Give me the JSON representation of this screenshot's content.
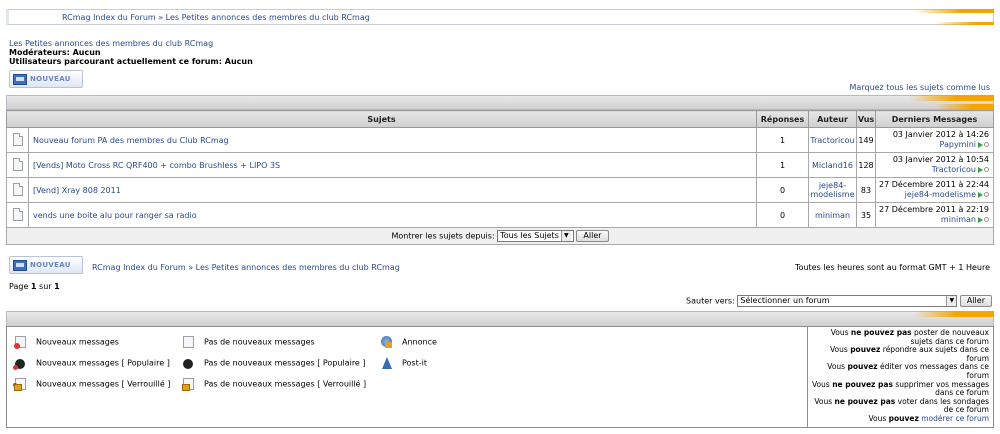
{
  "breadcrumb": {
    "index": "RCmag Index du Forum",
    "sep": " » ",
    "forum": "Les Petites annonces des membres du club RCmag"
  },
  "info": {
    "forum_title": "Les Petites annonces des membres du club RCmag",
    "moderators": "Modérateurs: Aucun",
    "users": "Utilisateurs parcourant actuellement ce forum: Aucun"
  },
  "new_button": "NOUVEAU",
  "mark_all": "Marquez tous les sujets comme lus",
  "table": {
    "headers": {
      "subjects": "Sujets",
      "replies": "Réponses",
      "author": "Auteur",
      "views": "Vus",
      "last": "Derniers Messages"
    },
    "rows": [
      {
        "title": "Nouveau forum PA des membres du Club RCmag",
        "replies": "1",
        "author": "Tractoricou",
        "views": "149",
        "date": "03 Janvier 2012 à 14:26",
        "last_by": "Papymini"
      },
      {
        "title": "[Vends] Moto Cross RC QRF400 + combo Brushless + LIPO 3S",
        "replies": "1",
        "author": "Micland16",
        "views": "128",
        "date": "03 Janvier 2012 à 10:54",
        "last_by": "Tractoricou"
      },
      {
        "title": "[Vend] Xray 808 2011",
        "replies": "0",
        "author": "jeje84-modelisme",
        "views": "83",
        "date": "27 Décembre 2011 à 22:44",
        "last_by": "jeje84-modelisme"
      },
      {
        "title": "vends une boite alu pour ranger sa radio",
        "replies": "0",
        "author": "miniman",
        "views": "35",
        "date": "27 Décembre 2011 à 22:19",
        "last_by": "miniman"
      }
    ],
    "filter_label": "Montrer les sujets depuis:",
    "filter_value": "Tous les Sujets",
    "go": "Aller"
  },
  "timezone": "Toutes les heures sont au format GMT + 1 Heure",
  "page": {
    "prefix": "Page ",
    "current": "1",
    "mid": " sur ",
    "total": "1"
  },
  "jump": {
    "label": "Sauter vers:",
    "value": "Sélectionner un forum",
    "go": "Aller"
  },
  "legend": {
    "new": "Nouveaux messages",
    "no_new": "Pas de nouveaux messages",
    "announce": "Annonce",
    "new_pop": "Nouveaux messages [ Populaire ]",
    "no_new_pop": "Pas de nouveaux messages [ Populaire ]",
    "sticky": "Post-it",
    "new_lock": "Nouveaux messages [ Verrouillé ]",
    "no_new_lock": "Pas de nouveaux messages [ Verrouillé ]"
  },
  "permissions": {
    "l1a": "Vous ",
    "l1b": "ne pouvez pas",
    "l1c": " poster de nouveaux sujets dans ce forum",
    "l2a": "Vous ",
    "l2b": "pouvez",
    "l2c": " répondre aux sujets dans ce forum",
    "l3a": "Vous ",
    "l3b": "pouvez",
    "l3c": " éditer vos messages dans ce forum",
    "l4a": "Vous ",
    "l4b": "ne pouvez pas",
    "l4c": " supprimer vos messages dans ce forum",
    "l5a": "Vous ",
    "l5b": "ne pouvez pas",
    "l5c": " voter dans les sondages de ce forum",
    "l6a": "Vous ",
    "l6b": "pouvez",
    "l6c": " ",
    "l6link": "modérer ce forum"
  }
}
